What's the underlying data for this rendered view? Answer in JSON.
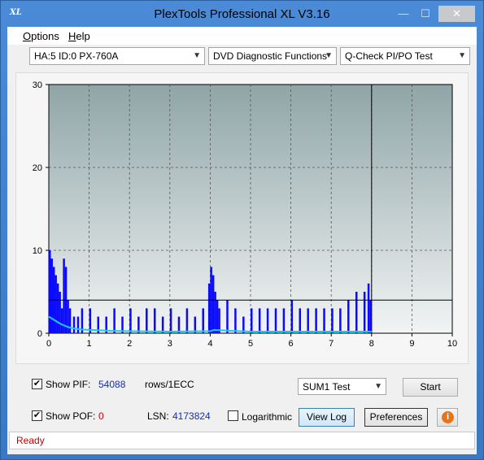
{
  "window": {
    "title": "PlexTools Professional XL V3.16",
    "app_icon_text": "XL",
    "minimize_symbol": "—",
    "maximize_symbol": "☐",
    "close_symbol": "✕"
  },
  "menu": {
    "options_accel": "O",
    "options_rest": "ptions",
    "help_accel": "H",
    "help_rest": "elp"
  },
  "toolbar": {
    "drive": "HA:5 ID:0  PX-760A",
    "function": "DVD Diagnostic Functions",
    "test": "Q-Check PI/PO Test",
    "arrow": "▼"
  },
  "chart_data": {
    "type": "bar",
    "title": "",
    "xlabel": "",
    "ylabel": "",
    "xlim": [
      0,
      10
    ],
    "ylim": [
      0,
      30
    ],
    "x_ticks": [
      "0",
      "1",
      "2",
      "3",
      "4",
      "5",
      "6",
      "7",
      "8",
      "9",
      "10"
    ],
    "y_ticks": [
      "0",
      "10",
      "20",
      "30"
    ],
    "grid": true,
    "scan_end_x": 8.0,
    "max_line_y": 4,
    "colors": {
      "bars": "#0a0aff",
      "sum_line": "#1ec8e8",
      "plot_bg_top": "#8fa5a7",
      "plot_bg_bottom": "#f2f4f4"
    },
    "series": [
      {
        "type": "bar",
        "x": [
          0.0,
          0.05,
          0.1,
          0.15,
          0.2,
          0.25,
          0.3,
          0.35,
          0.4,
          0.45,
          0.5,
          0.6,
          0.7,
          0.8,
          1.0,
          1.2,
          1.4,
          1.6,
          1.8,
          2.0,
          2.2,
          2.4,
          2.6,
          2.8,
          3.0,
          3.2,
          3.4,
          3.6,
          3.8,
          3.95,
          4.0,
          4.05,
          4.1,
          4.15,
          4.2,
          4.4,
          4.6,
          4.8,
          5.0,
          5.2,
          5.4,
          5.6,
          5.8,
          6.0,
          6.2,
          6.4,
          6.6,
          6.8,
          7.0,
          7.2,
          7.4,
          7.6,
          7.8,
          7.9,
          7.95
        ],
        "values": [
          10,
          9,
          8,
          7,
          6,
          5,
          3,
          9,
          8,
          4,
          3,
          2,
          2,
          3,
          3,
          2,
          2,
          3,
          2,
          3,
          2,
          3,
          3,
          2,
          3,
          2,
          3,
          2,
          3,
          6,
          8,
          7,
          5,
          4,
          3,
          4,
          3,
          2,
          3,
          3,
          3,
          3,
          3,
          4,
          3,
          3,
          3,
          3,
          3,
          3,
          4,
          5,
          5,
          6,
          4
        ]
      },
      {
        "type": "line",
        "x": [
          0,
          0.1,
          0.2,
          0.3,
          0.4,
          0.5,
          0.6,
          0.8,
          1.0,
          1.5,
          2.0,
          3.0,
          4.0,
          4.1,
          4.5,
          5.0,
          6.0,
          7.0,
          8.0
        ],
        "values": [
          2.0,
          1.7,
          1.4,
          1.1,
          0.9,
          0.7,
          0.6,
          0.45,
          0.4,
          0.3,
          0.25,
          0.2,
          0.25,
          0.4,
          0.3,
          0.2,
          0.2,
          0.2,
          0.2
        ]
      }
    ]
  },
  "controls": {
    "show_pif_label": "Show PIF:",
    "pif_value": "54088",
    "rows_label": "rows/1ECC",
    "sum_test": "SUM1 Test",
    "start_label": "Start",
    "show_pof_label": "Show POF:",
    "pof_value": "0",
    "lsn_label": "LSN:",
    "lsn_value": "4173824",
    "logarithmic_label": "Logarithmic",
    "view_log_label": "View Log",
    "preferences_label": "Preferences",
    "check_mark": "✔",
    "info_symbol": "i"
  },
  "status": {
    "text": "Ready"
  }
}
